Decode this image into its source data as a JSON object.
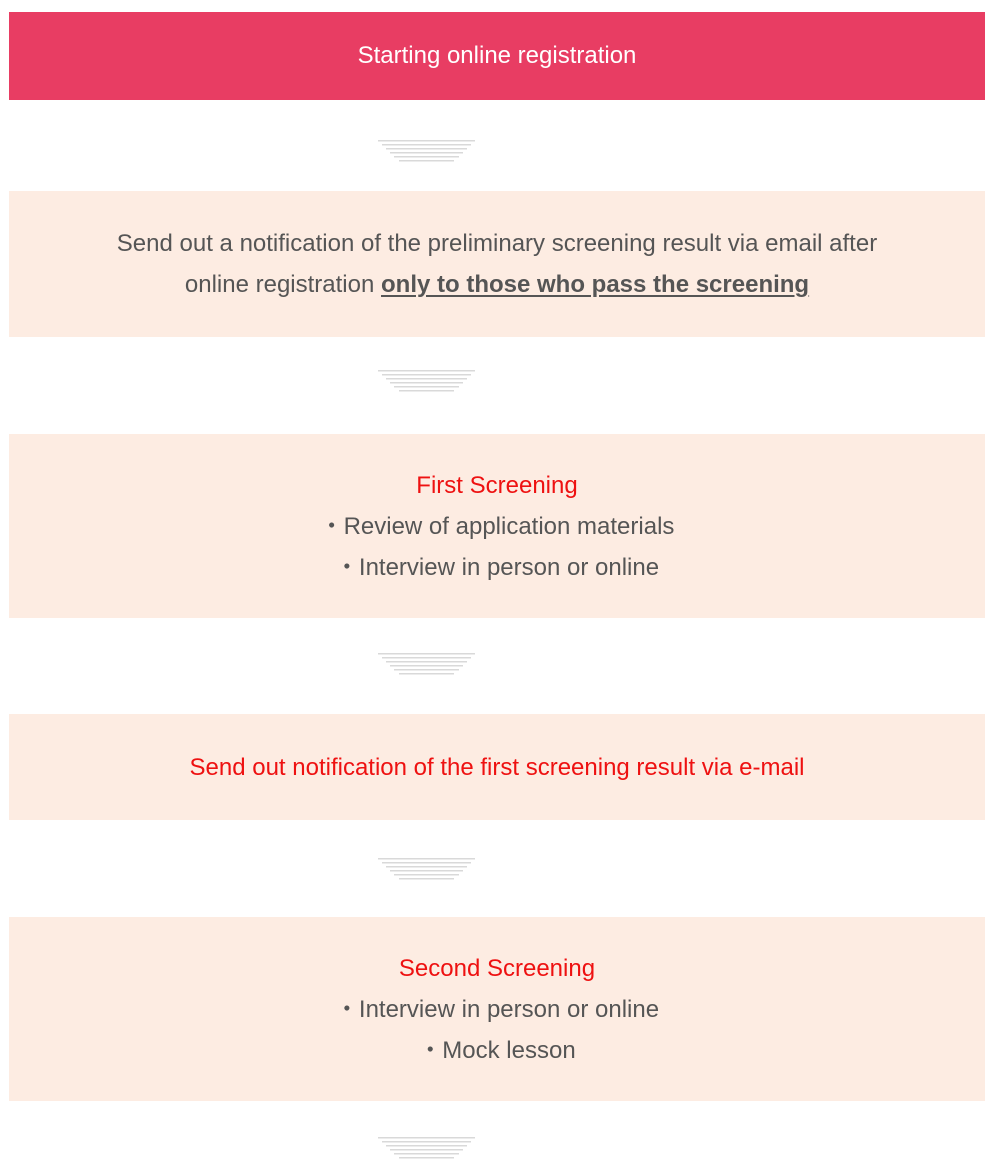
{
  "colors": {
    "header_bg": "#e83d63",
    "box_bg": "#fdece2",
    "arrow": "#d9d9d9",
    "accent_red": "#ee1111",
    "text_gray": "#555555"
  },
  "steps": [
    {
      "type": "header",
      "text": "Starting online registration"
    },
    {
      "type": "box",
      "line1": "Send out a notification of the preliminary screening result via email after",
      "line2_prefix": "online registration ",
      "line2_emphasis": "only to those who pass the screening"
    },
    {
      "type": "box",
      "title": "First Screening",
      "items": [
        "・Review of application materials",
        "・Interview in person or online"
      ]
    },
    {
      "type": "box",
      "title": "Send out notification of the first screening result via e-mail"
    },
    {
      "type": "box",
      "title": "Second Screening",
      "items": [
        "・Interview in person or online",
        "・Mock lesson"
      ]
    }
  ],
  "arrows": [
    {
      "icon": "down-arrow-icon"
    },
    {
      "icon": "down-arrow-icon"
    },
    {
      "icon": "down-arrow-icon"
    },
    {
      "icon": "down-arrow-icon"
    },
    {
      "icon": "down-arrow-icon"
    }
  ]
}
